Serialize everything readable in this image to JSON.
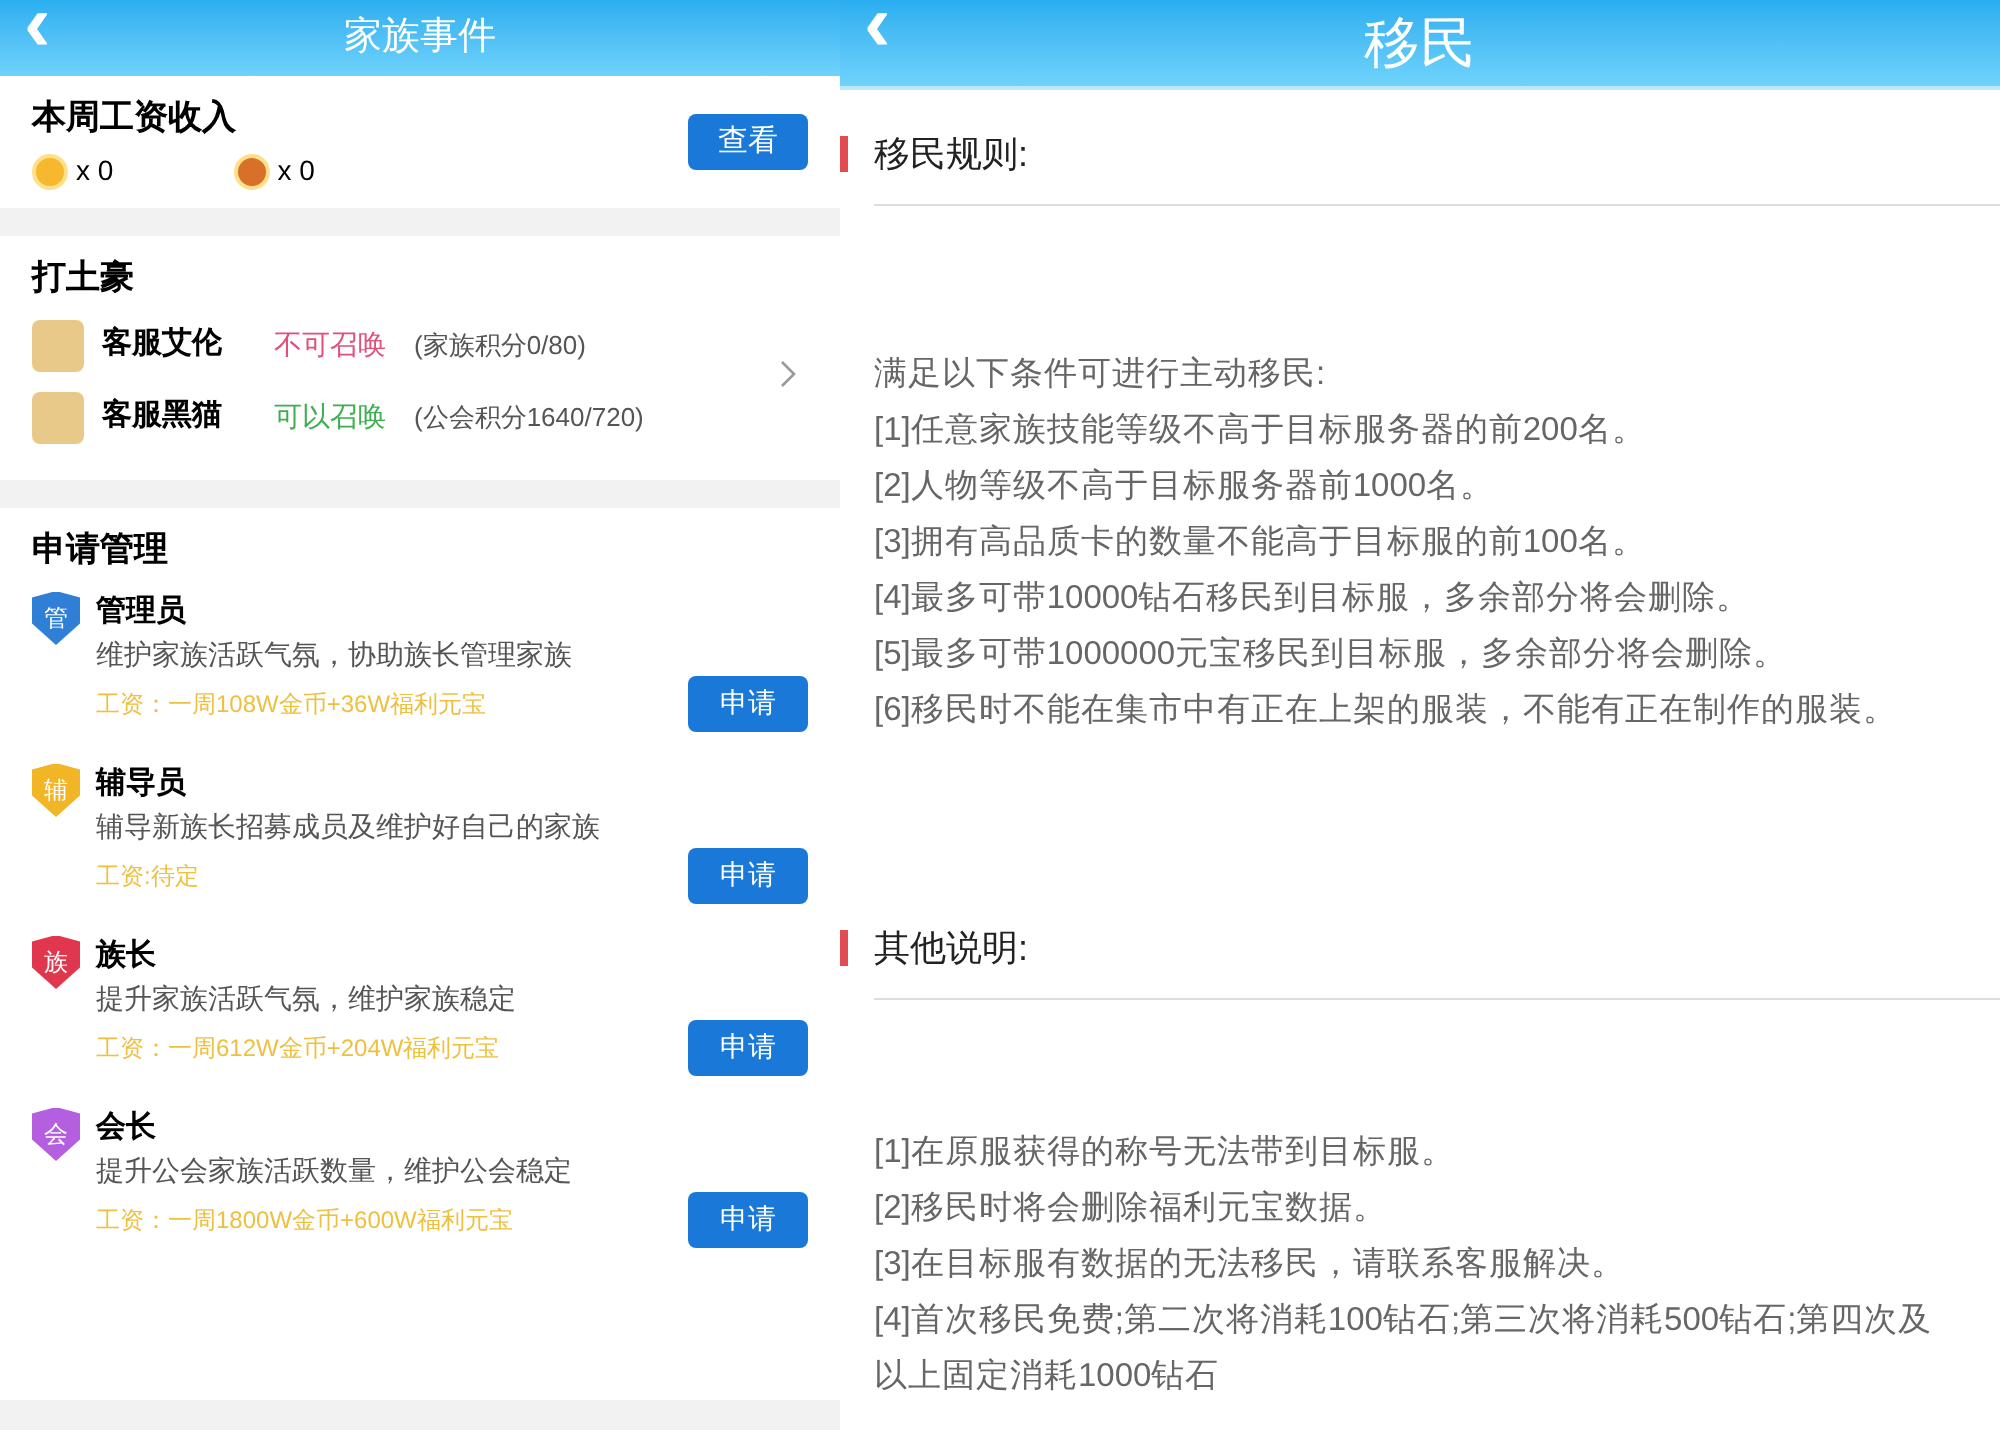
{
  "left": {
    "title": "家族事件",
    "back": "‹",
    "salary": {
      "heading": "本周工资收入",
      "coins": [
        {
          "amount": "x 0",
          "color": "#f5b82e"
        },
        {
          "amount": "x 0",
          "color": "#d8702a"
        }
      ],
      "button": "查看"
    },
    "tycoon": {
      "heading": "打土豪",
      "npcs": [
        {
          "name": "客服艾伦",
          "status": "不可召唤",
          "available": false,
          "score": "(家族积分0/80)"
        },
        {
          "name": "客服黑猫",
          "status": "可以召唤",
          "available": true,
          "score": "(公会积分1640/720)"
        }
      ]
    },
    "management": {
      "heading": "申请管理",
      "roles": [
        {
          "badge": "管",
          "color": "#2f7fd6",
          "title": "管理员",
          "desc": "维护家族活跃气氛，协助族长管理家族",
          "salary": "工资：一周108W金币+36W福利元宝",
          "button": "申请"
        },
        {
          "badge": "辅",
          "color": "#f2b526",
          "title": "辅导员",
          "desc": "辅导新族长招募成员及维护好自己的家族",
          "salary": "工资:待定",
          "button": "申请"
        },
        {
          "badge": "族",
          "color": "#e0364e",
          "title": "族长",
          "desc": "提升家族活跃气氛，维护家族稳定",
          "salary": "工资：一周612W金币+204W福利元宝",
          "button": "申请"
        },
        {
          "badge": "会",
          "color": "#b45ee0",
          "title": "会长",
          "desc": "提升公会家族活跃数量，维护公会稳定",
          "salary": "工资：一周1800W金币+600W福利元宝",
          "button": "申请"
        }
      ]
    }
  },
  "right": {
    "title": "移民",
    "back": "‹",
    "sections": [
      {
        "heading": "移民规则:",
        "lines": [
          "满足以下条件可进行主动移民:",
          "[1]任意家族技能等级不高于目标服务器的前200名。",
          "[2]人物等级不高于目标服务器前1000名。",
          "[3]拥有高品质卡的数量不能高于目标服的前100名。",
          "[4]最多可带10000钻石移民到目标服，多余部分将会删除。",
          "[5]最多可带1000000元宝移民到目标服，多余部分将会删除。",
          "[6]移民时不能在集市中有正在上架的服装，不能有正在制作的服装。"
        ]
      },
      {
        "heading": "其他说明:",
        "lines": [
          "[1]在原服获得的称号无法带到目标服。",
          "[2]移民时将会删除福利元宝数据。",
          "[3]在目标服有数据的无法移民，请联系客服解决。",
          "[4]首次移民免费;第二次将消耗100钻石;第三次将消耗500钻石;第四次及以上固定消耗1000钻石"
        ]
      }
    ]
  }
}
